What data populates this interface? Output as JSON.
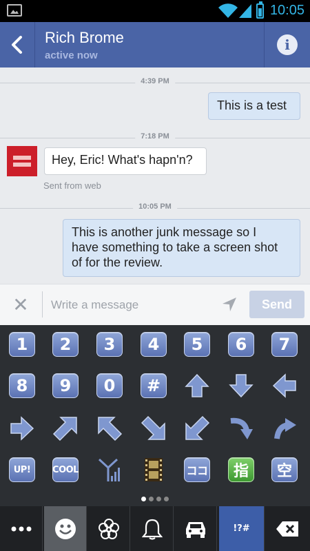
{
  "status_bar": {
    "time": "10:05",
    "accent": "#33b5e5"
  },
  "header": {
    "contact_name": "Rich Brome",
    "presence": "active now",
    "back_icon": "chevron-left-icon",
    "info_icon": "info-icon",
    "color": "#4a64a6"
  },
  "conversation": {
    "groups": [
      {
        "time": "4:39 PM",
        "message": {
          "direction": "outgoing",
          "text": "This is a test"
        }
      },
      {
        "time": "7:18 PM",
        "message": {
          "direction": "incoming",
          "text": "Hey, Eric! What's hapn'n?",
          "meta": "Sent from web"
        }
      },
      {
        "time": "10:05 PM",
        "message": {
          "direction": "outgoing",
          "lines": [
            "This is another junk message so I",
            "have something to take a screen shot",
            "of for the review."
          ]
        }
      }
    ]
  },
  "composer": {
    "clear_icon": "close-icon",
    "placeholder": "Write a message",
    "location_icon": "location-arrow-icon",
    "send_label": "Send"
  },
  "keyboard": {
    "rows": [
      [
        "1",
        "2",
        "3",
        "4",
        "5",
        "6",
        "7"
      ],
      [
        "8",
        "9",
        "0",
        "#",
        "up-arrow-icon",
        "down-arrow-icon",
        "left-arrow-icon"
      ],
      [
        "right-arrow-icon",
        "up-right-arrow-icon",
        "up-left-arrow-icon",
        "down-right-arrow-icon",
        "down-left-arrow-icon",
        "curve-down-arrow-icon",
        "curve-up-arrow-icon"
      ],
      [
        "UP!",
        "COOL",
        "antenna-icon",
        "film-icon",
        "ココ",
        "指",
        "空"
      ]
    ],
    "page_count": 4,
    "current_page": 1
  },
  "category_bar": {
    "tabs": [
      "more-icon",
      "smiley-icon",
      "flower-icon",
      "bell-icon",
      "car-icon",
      "!?#"
    ],
    "selected": "smiley-icon",
    "backspace_icon": "backspace-icon"
  }
}
